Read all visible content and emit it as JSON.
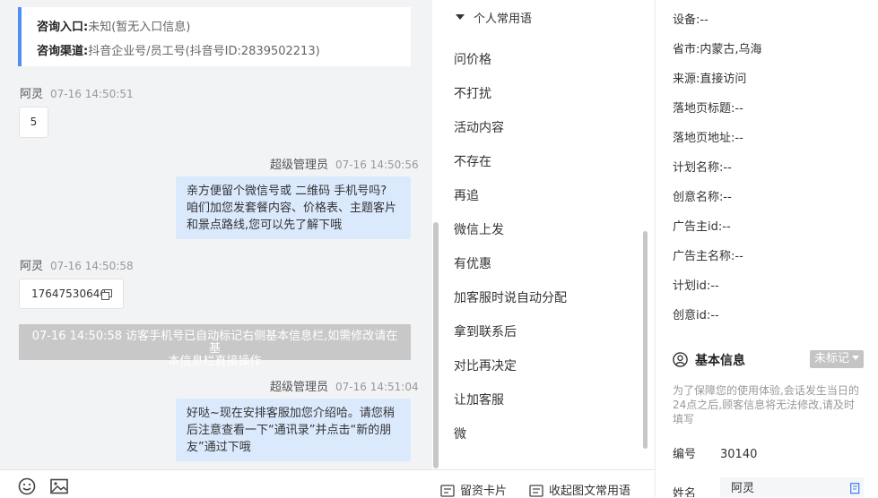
{
  "chat": {
    "info_card": {
      "entry_label": "咨询入口:",
      "entry_value": "未知(暂无入口信息)",
      "channel_label": "咨询渠道:",
      "channel_value": "抖音企业号/员工号(抖音号ID:2839502213)"
    },
    "messages": [
      {
        "sender": "阿灵",
        "time": "07-16 14:50:51",
        "text": "5"
      },
      {
        "sender": "超级管理员",
        "time": "07-16 14:50:56",
        "lines": [
          "亲方便留个微信号或 二维码 手机号吗?",
          "咱们加您发套餐内容、价格表、主题客片",
          "和景点路线,您可以先了解下哦"
        ]
      },
      {
        "sender": "阿灵",
        "time": "07-16 14:50:58",
        "text": "17647530646"
      },
      {
        "sender": "超级管理员",
        "time": "07-16 14:51:04",
        "lines": [
          "好哒~现在安排客服加您介绍哈。请您稍",
          "后注意查看一下“通讯录”并点击“新的朋",
          "友”通过下哦"
        ]
      }
    ],
    "system_notice": {
      "line1": "07-16 14:50:58 访客手机号已自动标记右侧基本信息栏,如需修改请在基",
      "line2": "本信息栏直接操作"
    },
    "toolbar_icons": [
      "emoji-icon",
      "image-icon"
    ]
  },
  "phrases": {
    "header": "个人常用语",
    "items": [
      "问价格",
      "不打扰",
      "活动内容",
      "不存在",
      "再追",
      "微信上发",
      "有优惠",
      "加客服时说自动分配",
      "拿到联系后",
      "对比再决定",
      "让加客服",
      "微"
    ]
  },
  "bottom_actions": {
    "card": "留资卡片",
    "collapse": "收起图文常用语"
  },
  "visitor": {
    "rows": [
      {
        "label": "设备:",
        "value": "--"
      },
      {
        "label": "省市:",
        "value": "内蒙古,乌海"
      },
      {
        "label": "来源:",
        "value": "直接访问"
      },
      {
        "label": "落地页标题:",
        "value": "--"
      },
      {
        "label": "落地页地址:",
        "value": "--"
      },
      {
        "label": "计划名称:",
        "value": "--"
      },
      {
        "label": "创意名称:",
        "value": "--"
      },
      {
        "label": "广告主id:",
        "value": "--"
      },
      {
        "label": "广告主名称:",
        "value": "--"
      },
      {
        "label": "计划id:",
        "value": "--"
      },
      {
        "label": "创意id:",
        "value": "--"
      }
    ],
    "basic_info_title": "基本信息",
    "tag_select": "未标记",
    "notice": "为了保障您的使用体验,会话发生当日的24点之后,顾客信息将无法修改,请及时填写",
    "id_label": "编号",
    "id_value": "30140",
    "name_label": "姓名",
    "name_value": "阿灵"
  }
}
